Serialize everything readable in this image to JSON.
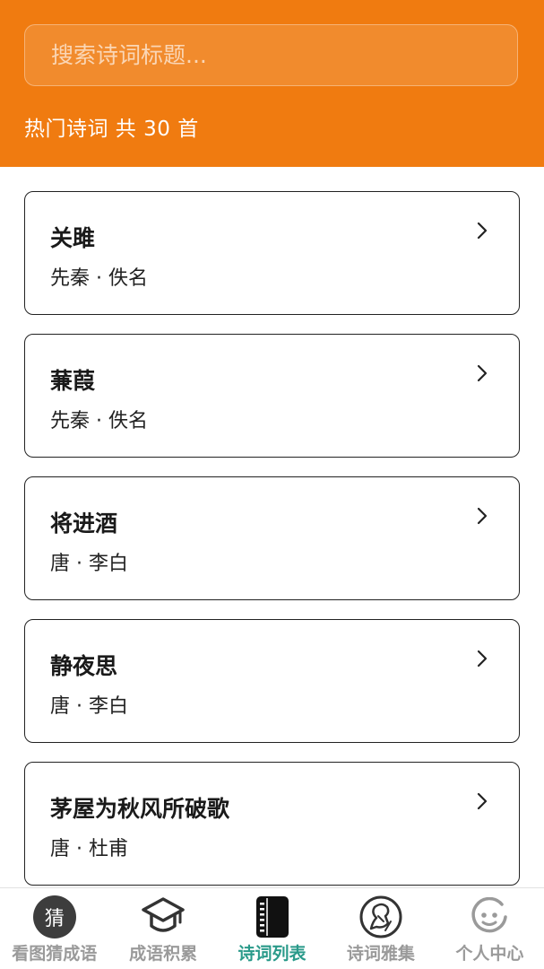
{
  "search": {
    "placeholder": "搜索诗词标题..."
  },
  "header": {
    "count_text": "热门诗词 共 30 首"
  },
  "poems": [
    {
      "title": "关雎",
      "meta": "先秦 · 佚名"
    },
    {
      "title": "蒹葭",
      "meta": "先秦 · 佚名"
    },
    {
      "title": "将进酒",
      "meta": "唐 · 李白"
    },
    {
      "title": "静夜思",
      "meta": "唐 · 李白"
    },
    {
      "title": "茅屋为秋风所破歌",
      "meta": "唐 · 杜甫"
    }
  ],
  "tabbar": {
    "tabs": [
      {
        "label": "看图猜成语",
        "icon": "guess-icon",
        "icon_text": "猜",
        "active": false
      },
      {
        "label": "成语积累",
        "icon": "graduation-cap-icon",
        "active": false
      },
      {
        "label": "诗词列表",
        "icon": "notebook-icon",
        "active": true
      },
      {
        "label": "诗词雅集",
        "icon": "poet-portrait-icon",
        "active": false
      },
      {
        "label": "个人中心",
        "icon": "smiley-icon",
        "active": false
      }
    ]
  },
  "colors": {
    "header_bg": "#f07b10",
    "active_tab": "#2a9a8a",
    "inactive_tab": "#9a9a9a"
  }
}
